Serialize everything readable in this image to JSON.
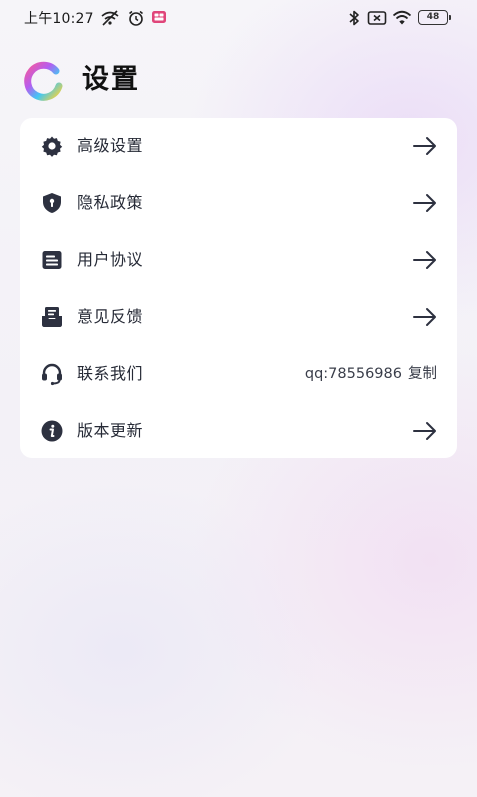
{
  "status_bar": {
    "time": "上午10:27",
    "battery": "48"
  },
  "header": {
    "title": "设置"
  },
  "settings": {
    "items": [
      {
        "label": "高级设置",
        "icon": "gear-icon"
      },
      {
        "label": "隐私政策",
        "icon": "shield-lock-icon"
      },
      {
        "label": "用户协议",
        "icon": "document-icon"
      },
      {
        "label": "意见反馈",
        "icon": "feedback-icon"
      },
      {
        "label": "联系我们",
        "icon": "headset-icon",
        "value": "qq:78556986",
        "action": "复制"
      },
      {
        "label": "版本更新",
        "icon": "info-icon"
      }
    ]
  },
  "colors": {
    "icon": "#2d3140",
    "card_bg": "#ffffff",
    "text": "#262a36"
  }
}
